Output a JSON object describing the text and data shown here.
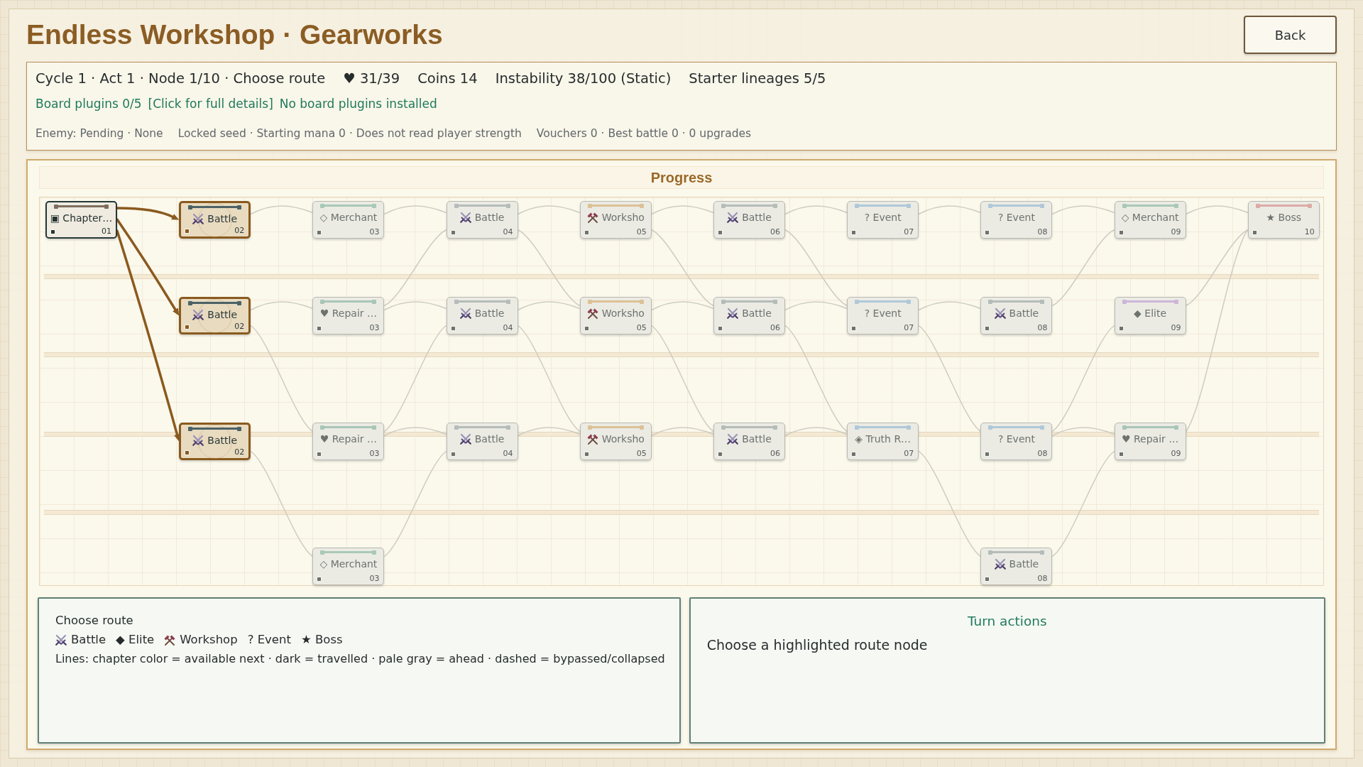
{
  "title": "Endless Workshop · Gearworks",
  "back_button": "Back",
  "status": {
    "route": "Cycle 1 · Act 1 · Node 1/10 · Choose route",
    "stats": [
      "♥ 31/39",
      "Coins 14",
      "Instability 38/100 (Static)",
      "Starter lineages 5/5"
    ],
    "plugins": {
      "count": "Board plugins 0/5",
      "link": "[Click for full details]",
      "note": "No board plugins installed"
    },
    "details": [
      "Enemy: Pending · None",
      "Locked seed · Starting mana 0 · Does not read player strength",
      "Vouchers 0 · Best battle 0 · 0 upgrades"
    ]
  },
  "progress": {
    "title": "Progress",
    "columns": [
      {
        "nodes": [
          {
            "label": "▣ Chapter…",
            "number": "01",
            "kind": "chapter",
            "current": true,
            "available": false,
            "links": [
              {
                "kind": "straight",
                "available": true
              },
              {
                "kind": "down",
                "available": true
              },
              {
                "kind": "down2",
                "available": true
              }
            ]
          }
        ]
      },
      {
        "nodes": [
          {
            "label": "Battle",
            "number": "02",
            "kind": "battle",
            "current": false,
            "available": true,
            "links": [
              {
                "kind": "straight",
                "available": false
              }
            ]
          },
          {
            "label": "Battle",
            "number": "02",
            "kind": "battle",
            "current": false,
            "available": true,
            "links": [
              {
                "kind": "straight",
                "available": false
              },
              {
                "kind": "down",
                "available": false
              }
            ]
          },
          {
            "label": "Battle",
            "number": "02",
            "kind": "battle",
            "current": false,
            "available": true,
            "links": [
              {
                "kind": "down",
                "available": false
              }
            ]
          }
        ]
      },
      {
        "nodes": [
          {
            "label": "◇ Merchant",
            "number": "03",
            "kind": "merchant",
            "current": false,
            "available": false,
            "links": [
              {
                "kind": "straight",
                "available": false
              }
            ]
          },
          {
            "label": "♥ Repair …",
            "number": "03",
            "kind": "repair",
            "current": false,
            "available": false,
            "links": [
              {
                "kind": "up",
                "available": false
              },
              {
                "kind": "straight",
                "available": false
              }
            ]
          },
          {
            "label": "♥ Repair …",
            "number": "03",
            "kind": "repair",
            "current": false,
            "available": false,
            "links": [
              {
                "kind": "up",
                "available": false
              },
              {
                "kind": "straight",
                "available": false
              }
            ]
          },
          {
            "label": "◇ Merchant",
            "number": "03",
            "kind": "merchant",
            "current": false,
            "available": false,
            "links": [
              {
                "kind": "up",
                "available": false
              }
            ]
          }
        ]
      },
      {
        "nodes": [
          {
            "label": "Battle",
            "number": "04",
            "kind": "battle",
            "current": false,
            "available": false,
            "links": [
              {
                "kind": "straight",
                "available": false
              },
              {
                "kind": "down",
                "available": false
              }
            ]
          },
          {
            "label": "Battle",
            "number": "04",
            "kind": "battle",
            "current": false,
            "available": false,
            "links": [
              {
                "kind": "straight",
                "available": false
              },
              {
                "kind": "down",
                "available": false
              }
            ]
          },
          {
            "label": "Battle",
            "number": "04",
            "kind": "battle",
            "current": false,
            "available": false,
            "links": [
              {
                "kind": "straight",
                "available": false
              }
            ]
          }
        ]
      },
      {
        "nodes": [
          {
            "label": "Worksho",
            "number": "05",
            "kind": "workshop",
            "current": false,
            "available": false,
            "links": [
              {
                "kind": "straight",
                "available": false
              },
              {
                "kind": "down",
                "available": false
              }
            ]
          },
          {
            "label": "Worksho",
            "number": "05",
            "kind": "workshop",
            "current": false,
            "available": false,
            "links": [
              {
                "kind": "straight",
                "available": false
              },
              {
                "kind": "down",
                "available": false
              }
            ]
          },
          {
            "label": "Worksho",
            "number": "05",
            "kind": "workshop",
            "current": false,
            "available": false,
            "links": [
              {
                "kind": "straight",
                "available": false
              }
            ]
          }
        ]
      },
      {
        "nodes": [
          {
            "label": "Battle",
            "number": "06",
            "kind": "battle",
            "current": false,
            "available": false,
            "links": [
              {
                "kind": "straight",
                "available": false
              },
              {
                "kind": "down",
                "available": false
              }
            ]
          },
          {
            "label": "Battle",
            "number": "06",
            "kind": "battle",
            "current": false,
            "available": false,
            "links": [
              {
                "kind": "straight",
                "available": false
              },
              {
                "kind": "down",
                "available": false
              }
            ]
          },
          {
            "label": "Battle",
            "number": "06",
            "kind": "battle",
            "current": false,
            "available": false,
            "links": [
              {
                "kind": "straight",
                "available": false
              }
            ]
          }
        ]
      },
      {
        "nodes": [
          {
            "label": "? Event",
            "number": "07",
            "kind": "event",
            "current": false,
            "available": false,
            "links": [
              {
                "kind": "straight",
                "available": false
              }
            ]
          },
          {
            "label": "? Event",
            "number": "07",
            "kind": "event",
            "current": false,
            "available": false,
            "links": [
              {
                "kind": "straight",
                "available": false
              },
              {
                "kind": "down",
                "available": false
              }
            ]
          },
          {
            "label": "◈ Truth R…",
            "number": "07",
            "kind": "truth",
            "current": false,
            "available": false,
            "links": [
              {
                "kind": "down",
                "available": false
              }
            ]
          }
        ]
      },
      {
        "nodes": [
          {
            "label": "? Event",
            "number": "08",
            "kind": "event",
            "current": false,
            "available": false,
            "links": [
              {
                "kind": "straight",
                "available": false
              }
            ]
          },
          {
            "label": "Battle",
            "number": "08",
            "kind": "battle",
            "current": false,
            "available": false,
            "links": [
              {
                "kind": "up",
                "available": false
              }
            ]
          },
          {
            "label": "? Event",
            "number": "08",
            "kind": "event",
            "current": false,
            "available": false,
            "links": [
              {
                "kind": "up",
                "available": false
              },
              {
                "kind": "straight",
                "available": false
              }
            ]
          },
          {
            "label": "Battle",
            "number": "08",
            "kind": "battle",
            "current": false,
            "available": false,
            "links": [
              {
                "kind": "up",
                "available": false
              }
            ]
          }
        ]
      },
      {
        "nodes": [
          {
            "label": "◇ Merchant",
            "number": "09",
            "kind": "merchant",
            "current": false,
            "available": false,
            "links": [
              {
                "kind": "straight",
                "available": false
              }
            ]
          },
          {
            "label": "◆ Elite",
            "number": "09",
            "kind": "elite",
            "current": false,
            "available": false,
            "links": [
              {
                "kind": "up",
                "available": false
              }
            ]
          },
          {
            "label": "♥ Repair …",
            "number": "09",
            "kind": "repair",
            "current": false,
            "available": false,
            "links": [
              {
                "kind": "up2",
                "available": false
              }
            ]
          }
        ]
      },
      {
        "nodes": [
          {
            "label": "★ Boss",
            "number": "10",
            "kind": "boss",
            "current": false,
            "available": false
          }
        ]
      }
    ]
  },
  "legend_panel": {
    "title": "Choose route",
    "legend": [
      {
        "kind": "battle",
        "label": "Battle"
      },
      {
        "kind": "elite",
        "label": "◆ Elite"
      },
      {
        "kind": "workshop",
        "label": "Workshop"
      },
      {
        "kind": "event",
        "label": "? Event"
      },
      {
        "kind": "boss",
        "label": "★ Boss"
      }
    ],
    "lines_note": "Lines: chapter color = available next · dark = travelled · pale gray = ahead · dashed = bypassed/collapsed"
  },
  "actions_panel": {
    "title": "Turn actions",
    "prompt": "Choose a highlighted route node"
  }
}
